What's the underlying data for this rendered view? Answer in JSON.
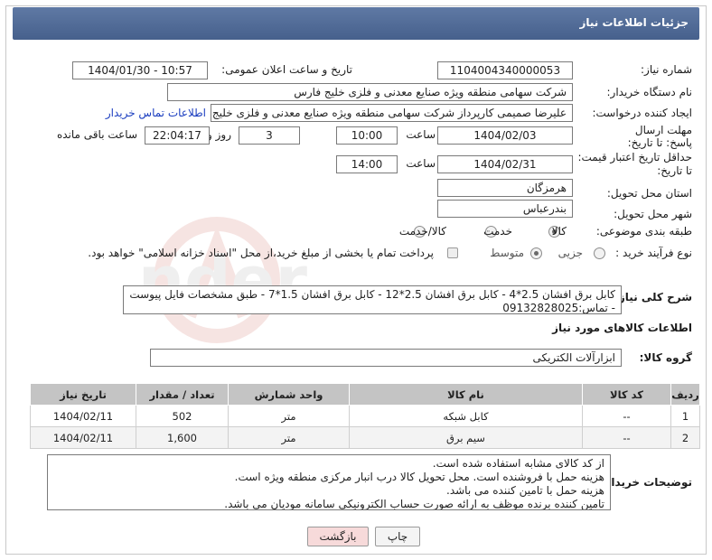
{
  "header": {
    "title": "جزئیات اطلاعات نیاز"
  },
  "fields": {
    "need_number_label": "شماره نیاز:",
    "need_number": "1104004340000053",
    "announce_label": "تاریخ و ساعت اعلان عمومی:",
    "announce_value": "1404/01/30 - 10:57",
    "buyer_org_label": "نام دستگاه خریدار:",
    "buyer_org": "شرکت سهامی منطقه ویژه صنایع معدنی و فلزی خلیج فارس",
    "creator_label": "ایجاد کننده درخواست:",
    "creator": "علیرضا صمیمی کارپرداز شرکت سهامی منطقه ویژه صنایع معدنی و فلزی خلیج فارس",
    "contact_link": "اطلاعات تماس خریدار",
    "reply_deadline_label": "مهلت ارسال پاسخ: تا تاریخ:",
    "reply_date": "1404/02/03",
    "time_label": "ساعت",
    "reply_time": "10:00",
    "days_count": "3",
    "days_label": "روز و",
    "remaining_time": "22:04:17",
    "remaining_label": "ساعت باقی مانده",
    "price_validity_label_1": "حداقل تاریخ اعتبار قیمت:",
    "price_validity_label_2": "تا تاریخ:",
    "price_date": "1404/02/31",
    "price_time": "14:00",
    "province_label": "استان محل تحویل:",
    "province": "هرمزگان",
    "city_label": "شهر محل تحویل:",
    "city": "بندرعباس",
    "category_label": "طبقه بندی موضوعی:",
    "category_options": [
      "کالا",
      "خدمت",
      "کالا/خدمت"
    ],
    "purchase_type_label": "نوع فرآیند خرید :",
    "purchase_options": [
      "جزیی",
      "متوسط"
    ],
    "payment_note": "پرداخت تمام یا بخشی از مبلغ خرید،از محل \"اسناد خزانه اسلامی\" خواهد بود."
  },
  "summary": {
    "label": "شرح کلی نیاز:",
    "text": "کابل برق افشان 2.5*4 - کابل برق افشان 2.5*12 - کابل برق افشان 1.5*7 - طبق مشخصات فایل پیوست - تماس:09132828025"
  },
  "goods_section": {
    "title": "اطلاعات کالاهای مورد نیاز",
    "group_label": "گروه کالا:",
    "group_value": "ابزارآلات الکتریکی"
  },
  "table": {
    "headers": [
      "ردیف",
      "کد کالا",
      "نام کالا",
      "واحد شمارش",
      "تعداد / مقدار",
      "تاریخ نیاز"
    ],
    "rows": [
      [
        "1",
        "--",
        "کابل شبکه",
        "متر",
        "502",
        "1404/02/11"
      ],
      [
        "2",
        "--",
        "سیم برق",
        "متر",
        "1,600",
        "1404/02/11"
      ]
    ]
  },
  "buyer_notes": {
    "label": "توضیحات خریدار:",
    "lines": [
      "از کد کالای مشابه استفاده شده است.",
      "هزینه حمل با فروشنده است. محل تحویل کالا درب انبار مرکزی منطقه ویژه است.",
      "هزینه حمل با تامین کننده می باشد.",
      "تامین کننده برنده موظف به ارائه صورت حساب الکترونیکی سامانه مودیان می باشد."
    ]
  },
  "buttons": {
    "print": "چاپ",
    "back": "بازگشت"
  },
  "colors": {
    "header": "#4f6994",
    "link": "#1a3dbf",
    "print_btn": "#f4f4f4",
    "back_btn": "#f7dada"
  }
}
